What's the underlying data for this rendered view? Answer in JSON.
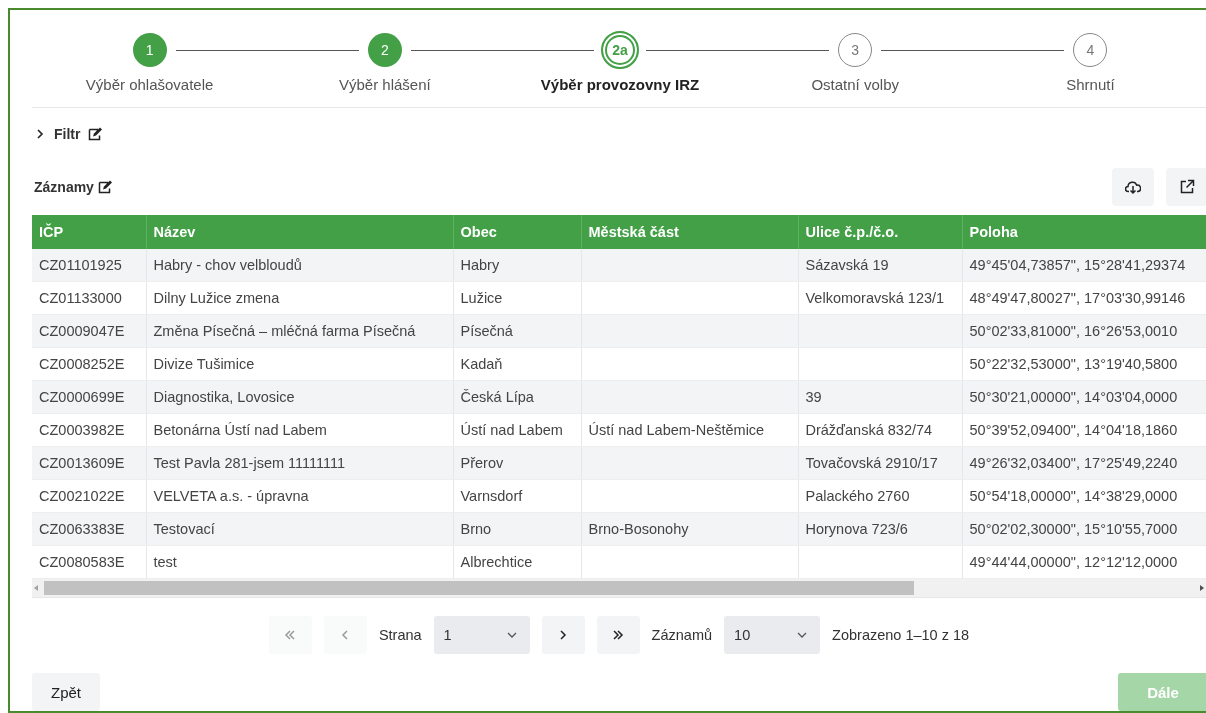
{
  "steps": [
    {
      "number": "1",
      "label": "Výběr ohlašovatele",
      "completed": true,
      "selected": false
    },
    {
      "number": "2",
      "label": "Výběr hlášení",
      "completed": true,
      "selected": false
    },
    {
      "number": "2a",
      "label": "Výběr provozovny IRZ",
      "completed": false,
      "selected": true
    },
    {
      "number": "3",
      "label": "Ostatní volby",
      "completed": false,
      "selected": false
    },
    {
      "number": "4",
      "label": "Shrnutí",
      "completed": false,
      "selected": false
    }
  ],
  "filter": {
    "label": "Filtr",
    "expanded": false
  },
  "records": {
    "label": "Záznamy"
  },
  "table": {
    "columns": [
      "IČP",
      "Název",
      "Obec",
      "Městská část",
      "Ulice č.p./č.o.",
      "Poloha"
    ],
    "rows": [
      [
        "CZ01101925",
        "Habry - chov velbloudů",
        "Habry",
        "",
        "Sázavská 19",
        "49°45'04,73857\", 15°28'41,29374"
      ],
      [
        "CZ01133000",
        "Dilny Lužice zmena",
        "Lužice",
        "",
        "Velkomoravská 123/1",
        "48°49'47,80027\", 17°03'30,99146"
      ],
      [
        "CZ0009047E",
        "Změna Písečná – mléčná farma Písečná",
        "Písečná",
        "",
        "",
        "50°02'33,81000\", 16°26'53,0010"
      ],
      [
        "CZ0008252E",
        "Divize Tušimice",
        "Kadaň",
        "",
        "",
        "50°22'32,53000\", 13°19'40,5800"
      ],
      [
        "CZ0000699E",
        "Diagnostika, Lovosice",
        "Česká Lípa",
        "",
        "39",
        "50°30'21,00000\", 14°03'04,0000"
      ],
      [
        "CZ0003982E",
        "Betonárna Ústí nad Labem",
        "Ústí nad Labem",
        "Ústí nad Labem-Neštěmice",
        "Drážďanská 832/74",
        "50°39'52,09400\", 14°04'18,1860"
      ],
      [
        "CZ0013609E",
        "Test Pavla 281-jsem 11111111",
        "Přerov",
        "",
        "Tovačovská 2910/17",
        "49°26'32,03400\", 17°25'49,2240"
      ],
      [
        "CZ0021022E",
        "VELVETA a.s. - úpravna",
        "Varnsdorf",
        "",
        "Palackého 2760",
        "50°54'18,00000\", 14°38'29,0000"
      ],
      [
        "CZ0063383E",
        "Testovací",
        "Brno",
        "Brno-Bosonohy",
        "Horynova 723/6",
        "50°02'02,30000\", 15°10'55,7000"
      ],
      [
        "CZ0080583E",
        "test",
        "Albrechtice",
        "",
        "",
        "49°44'44,00000\", 12°12'12,0000"
      ]
    ]
  },
  "pager": {
    "first_disabled": true,
    "prev_disabled": true,
    "next_disabled": false,
    "last_disabled": false,
    "page_label": "Strana",
    "page": "1",
    "size_label": "Záznamů",
    "size": "10",
    "summary": "Zobrazeno 1–10 z 18"
  },
  "footer": {
    "back": "Zpět",
    "next": "Dále",
    "next_disabled": true
  }
}
